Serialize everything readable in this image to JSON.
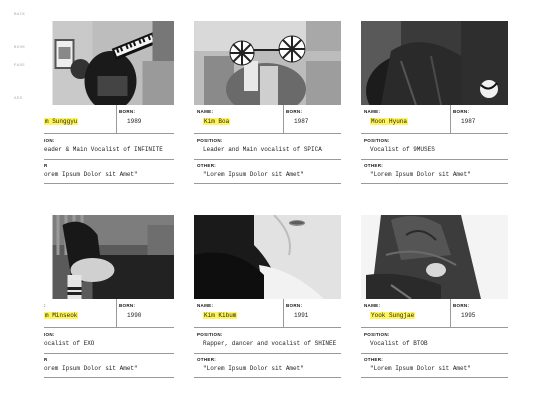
{
  "nav": {
    "items": [
      "BACK",
      "BOOK",
      "PAGE",
      "ADD"
    ]
  },
  "labels": {
    "name": "NAME:",
    "born": "BORN:",
    "position": "POSITION:",
    "other": "OTHER:"
  },
  "cards": [
    {
      "name": "Kim Sunggyu",
      "name_visible": "m Sunggyu",
      "born": "1989",
      "position": "Leader & Main Vocalist of INFINITE",
      "position_visible": "eader & Main Vocalist of INFINITE",
      "name_label_visible": "",
      "position_label_visible": "ION:",
      "other_label_visible": "R",
      "other": "\"Lorem Ipsum Dolor sit Amet\"",
      "other_visible": "orem Ipsum Dolor sit Amet\"",
      "image": "person-with-keyboard-photo"
    },
    {
      "name": "Kim Boa",
      "born": "1987",
      "position": "Leader and Main vocalist of SPICA",
      "other": "\"Lorem Ipsum Dolor sit Amet\"",
      "image": "person-with-flag-glasses-photo"
    },
    {
      "name": "Moon Hyuna",
      "born": "1987",
      "position": "Vocalist of 9MUSES",
      "other": "\"Lorem Ipsum Dolor sit Amet\"",
      "image": "person-in-leather-jacket-photo"
    },
    {
      "name": "Kim Minseok",
      "name_visible": "m Minseok",
      "born": "1990",
      "position": "Vocalist of EXO",
      "position_visible": "ocalist of EXO",
      "name_label_visible": ":",
      "position_label_visible": "ION:",
      "other_label_visible": "R",
      "other": "\"Lorem Ipsum Dolor sit Amet\"",
      "other_visible": "orem Ipsum Dolor sit Amet\"",
      "image": "person-seated-photo"
    },
    {
      "name": "Kim Kibum",
      "born": "1991",
      "position": "Rapper, dancer and vocalist of SHINEE",
      "other": "\"Lorem Ipsum Dolor sit Amet\"",
      "image": "person-lips-shoulder-photo"
    },
    {
      "name": "Yook Sungjae",
      "born": "1995",
      "position": "Vocalist of BTOB",
      "other": "\"Lorem Ipsum Dolor sit Amet\"",
      "image": "person-in-jacket-photo"
    }
  ]
}
